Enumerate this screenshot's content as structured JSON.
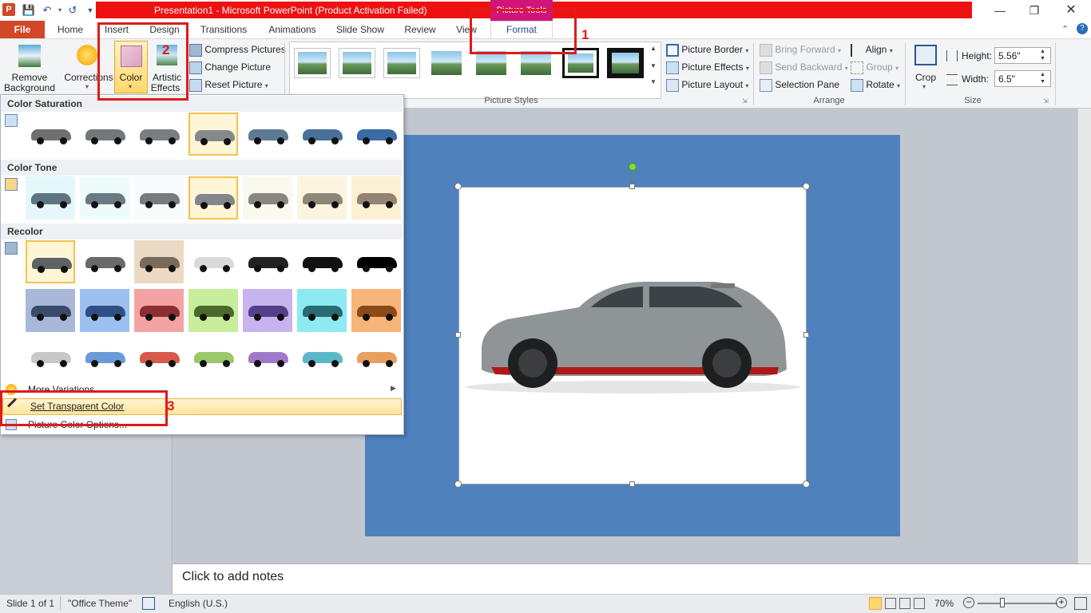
{
  "title_bar": {
    "title": "Presentation1  -  Microsoft PowerPoint (Product Activation Failed)",
    "context_group": "Picture Tools"
  },
  "tabs": {
    "file": "File",
    "home": "Home",
    "insert": "Insert",
    "design": "Design",
    "transitions": "Transitions",
    "animations": "Animations",
    "slide_show": "Slide Show",
    "review": "Review",
    "view": "View",
    "format": "Format"
  },
  "ribbon": {
    "remove_background_1": "Remove",
    "remove_background_2": "Background",
    "corrections": "Corrections",
    "color": "Color",
    "artistic_1": "Artistic",
    "artistic_2": "Effects",
    "compress": "Compress Pictures",
    "change": "Change Picture",
    "reset": "Reset Picture",
    "picture_styles": "Picture Styles",
    "picture_border": "Picture Border",
    "picture_effects": "Picture Effects",
    "picture_layout": "Picture Layout",
    "bring_forward": "Bring Forward",
    "send_backward": "Send Backward",
    "selection_pane": "Selection Pane",
    "align": "Align",
    "group": "Group",
    "rotate": "Rotate",
    "arrange": "Arrange",
    "crop": "Crop",
    "height_label": "Height:",
    "height_value": "5.56\"",
    "width_label": "Width:",
    "width_value": "6.5\"",
    "size": "Size"
  },
  "dropdown": {
    "color_saturation": "Color Saturation",
    "color_tone": "Color Tone",
    "recolor": "Recolor",
    "more_variations": "More Variations",
    "set_transparent": "Set Transparent Color",
    "picture_color_options": "Picture Color Options..."
  },
  "annotations": {
    "n1": "1",
    "n2": "2",
    "n3": "3"
  },
  "notes": {
    "placeholder": "Click to add notes"
  },
  "status": {
    "slide": "Slide 1 of 1",
    "theme": "\"Office Theme\"",
    "language": "English (U.S.)",
    "zoom": "70%"
  },
  "colors": {
    "accent": "#d24726",
    "title_red": "#ee1111",
    "picture_tools": "#d0147a",
    "slide_bg": "#4f81bd",
    "highlight": "#ffe59a",
    "annotation_red": "#e01a1a"
  }
}
